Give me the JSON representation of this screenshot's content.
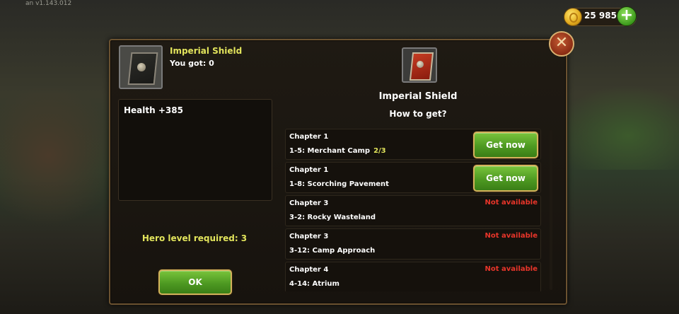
{
  "version": "an v1.143.012",
  "currency": {
    "gold": "25 985",
    "add_icon": "plus-icon"
  },
  "item": {
    "name": "Imperial Shield",
    "owned_label": "You got:  0",
    "stats": [
      "Health +385"
    ],
    "level_required": "Hero level required:  3",
    "ok_label": "OK"
  },
  "sources_panel": {
    "title": "Imperial Shield",
    "subtitle": "How to get?",
    "rows": [
      {
        "chapter": "Chapter 1",
        "stage": "1-5: Merchant Camp",
        "progress": "2/3",
        "action": "Get now",
        "status": ""
      },
      {
        "chapter": "Chapter 1",
        "stage": "1-8: Scorching Pavement",
        "progress": "",
        "action": "Get now",
        "status": ""
      },
      {
        "chapter": "Chapter 3",
        "stage": "3-2: Rocky Wasteland",
        "progress": "",
        "action": "",
        "status": "Not available"
      },
      {
        "chapter": "Chapter 3",
        "stage": "3-12: Camp Approach",
        "progress": "",
        "action": "",
        "status": "Not available"
      },
      {
        "chapter": "Chapter 4",
        "stage": "4-14: Atrium",
        "progress": "",
        "action": "",
        "status": "Not available"
      }
    ]
  },
  "colors": {
    "accent_yellow": "#e2e45c",
    "unavailable_red": "#e8352a",
    "button_green": "#4e9a22"
  }
}
